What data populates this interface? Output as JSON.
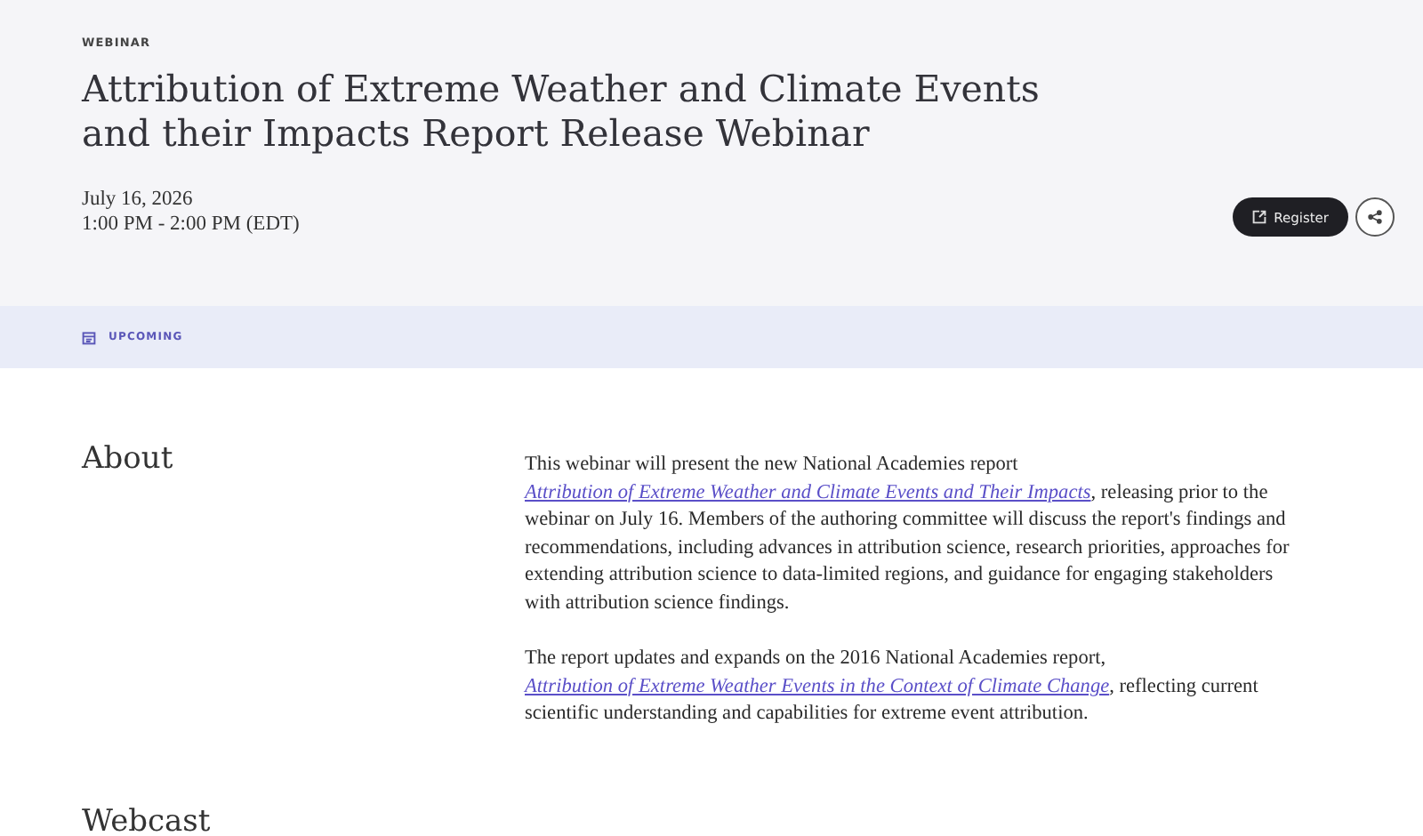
{
  "header": {
    "eyebrow": "WEBINAR",
    "title": "Attribution of Extreme Weather and Climate Events and their Impacts Report Release Webinar",
    "date": "July 16, 2026",
    "time": "1:00 PM - 2:00 PM (EDT)",
    "register_button": "Register"
  },
  "status": {
    "label": "UPCOMING"
  },
  "about": {
    "heading": "About",
    "paragraphs": [
      [
        {
          "kind": "text",
          "text": "This webinar will present the new National Academies report "
        },
        {
          "kind": "link",
          "text": "Attribution of Extreme Weather and Climate Events and Their Impacts"
        },
        {
          "kind": "text",
          "text": ", releasing prior to the webinar on July 16. Members of the authoring committee will discuss the report's findings and recommendations, including advances in attribution science, research priorities, approaches for extending attribution science to data-limited regions, and guidance for engaging stakeholders with attribution science findings."
        }
      ],
      [
        {
          "kind": "text",
          "text": "The report updates and expands on the 2016 National Academies report, "
        },
        {
          "kind": "link",
          "text": "Attribution of Extreme Weather Events in the Context of Climate Change"
        },
        {
          "kind": "text",
          "text": ", reflecting current scientific understanding and capabilities for extreme event attribution."
        }
      ]
    ]
  },
  "webcast": {
    "heading": "Webcast"
  }
}
